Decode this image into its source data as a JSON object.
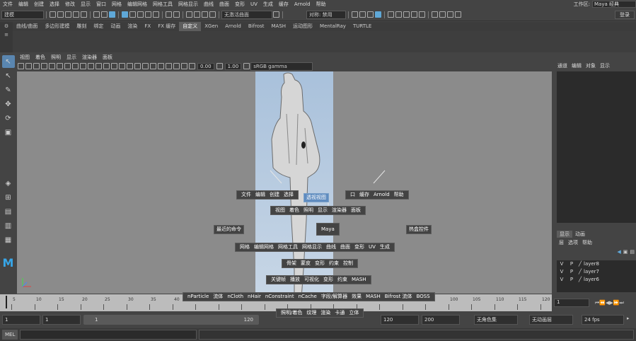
{
  "menubar": {
    "items": [
      "文件",
      "编辑",
      "创建",
      "选择",
      "修改",
      "显示",
      "窗口",
      "网格",
      "编辑网格",
      "网格工具",
      "网格显示",
      "曲线",
      "曲面",
      "变形",
      "UV",
      "生成",
      "缓存",
      "Arnold",
      "帮助"
    ],
    "workspace_label": "工作区:",
    "workspace_value": "Maya 经典"
  },
  "statusline": {
    "mode_value": "建模",
    "live_surface": "无激活曲面",
    "symmetry": "对称: 禁用",
    "login": "登录"
  },
  "shelf_tabs": [
    "曲线/曲面",
    "多边形建模",
    "雕刻",
    "绑定",
    "动画",
    "渲染",
    "FX",
    "FX 缓存",
    "自定义",
    "XGen",
    "Arnold",
    "Bifrost",
    "MASH",
    "运动图形",
    "MentalRay",
    "TURTLE"
  ],
  "shelf_active": "自定义",
  "panel_menu": [
    "视图",
    "着色",
    "照明",
    "显示",
    "渲染器",
    "面板"
  ],
  "panel_toolbar": {
    "exposure": "0.00",
    "gamma": "1.00",
    "color_space": "sRGB gamma"
  },
  "hotbox": {
    "row1": [
      "文件",
      "编辑",
      "创建",
      "选择"
    ],
    "row1_right": [
      "口",
      "缓存",
      "Arnold",
      "帮助"
    ],
    "highlight": "透视视图",
    "row2": [
      "视图",
      "着色",
      "照明",
      "显示",
      "渲染器",
      "面板"
    ],
    "left_item": "最近的命令",
    "center_item": "Maya",
    "right_item": "热盒控件",
    "row3": [
      "网格",
      "编辑网格",
      "网格工具",
      "网格显示",
      "曲线",
      "曲面",
      "变形",
      "UV",
      "生成"
    ],
    "row4": [
      "骨架",
      "蒙皮",
      "变形",
      "约束",
      "控制"
    ],
    "row5": [
      "关键帧",
      "播放",
      "可视化",
      "变形",
      "约束",
      "MASH"
    ],
    "row6": [
      "nParticle",
      "流体",
      "nCloth",
      "nHair",
      "nConstraint",
      "nCache",
      "字段/解算器",
      "效果",
      "MASH",
      "Bifrost 流体",
      "BOSS"
    ],
    "row7": [
      "照明/着色",
      "纹理",
      "渲染",
      "卡通",
      "立体"
    ]
  },
  "right_panel": {
    "menu": [
      "通道",
      "编辑",
      "对象",
      "显示"
    ],
    "layer_tabs": [
      "显示",
      "动画"
    ],
    "layer_menu": [
      "层",
      "选项",
      "帮助"
    ],
    "layers": [
      {
        "v": "V",
        "p": "P",
        "name": "layer8"
      },
      {
        "v": "V",
        "p": "P",
        "name": "layer7"
      },
      {
        "v": "V",
        "p": "P",
        "name": "layer6"
      }
    ]
  },
  "timeline": {
    "ticks": [
      "5",
      "10",
      "15",
      "20",
      "25",
      "30",
      "35",
      "40",
      "45",
      "50",
      "55",
      "60",
      "65",
      "70",
      "75",
      "80",
      "85",
      "90",
      "95",
      "100",
      "105",
      "110",
      "115",
      "120"
    ],
    "current_frame": "1"
  },
  "range": {
    "start": "1",
    "playback_start": "1",
    "slider_start": "1",
    "slider_end": "120",
    "playback_end": "120",
    "end": "200",
    "character_set": "无角色集",
    "anim_layer": "无动画层",
    "fps": "24 fps"
  },
  "cmdline": {
    "label": "MEL"
  }
}
